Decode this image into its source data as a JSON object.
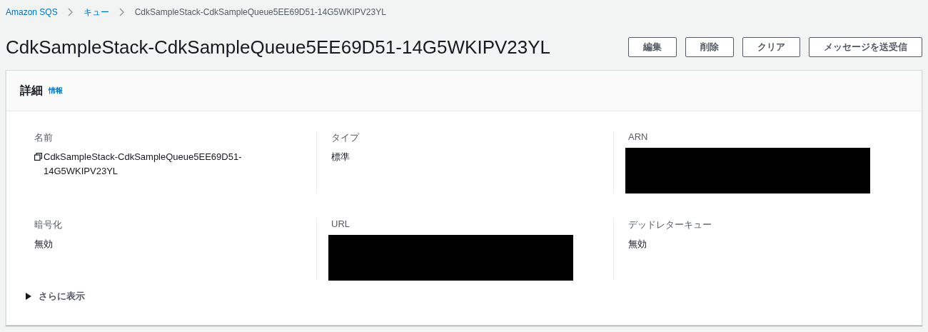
{
  "breadcrumb": [
    {
      "label": "Amazon SQS",
      "link": true
    },
    {
      "label": "キュー",
      "link": true
    },
    {
      "label": "CdkSampleStack-CdkSampleQueue5EE69D51-14G5WKIPV23YL",
      "link": false
    }
  ],
  "page_title": "CdkSampleStack-CdkSampleQueue5EE69D51-14G5WKIPV23YL",
  "actions": [
    "編集",
    "削除",
    "クリア",
    "メッセージを送受信"
  ],
  "details": {
    "title": "詳細",
    "info_link": "情報",
    "fields": [
      {
        "label": "名前",
        "kind": "copyable",
        "value": "CdkSampleStack-CdkSampleQueue5EE69D51-14G5WKIPV23YL"
      },
      {
        "label": "タイプ",
        "kind": "text",
        "value": "標準"
      },
      {
        "label": "ARN",
        "kind": "redacted"
      },
      {
        "label": "暗号化",
        "kind": "text",
        "value": "無効"
      },
      {
        "label": "URL",
        "kind": "redacted"
      },
      {
        "label": "デッドレターキュー",
        "kind": "text",
        "value": "無効"
      }
    ],
    "expander": {
      "label": "さらに表示",
      "expanded": false
    }
  }
}
